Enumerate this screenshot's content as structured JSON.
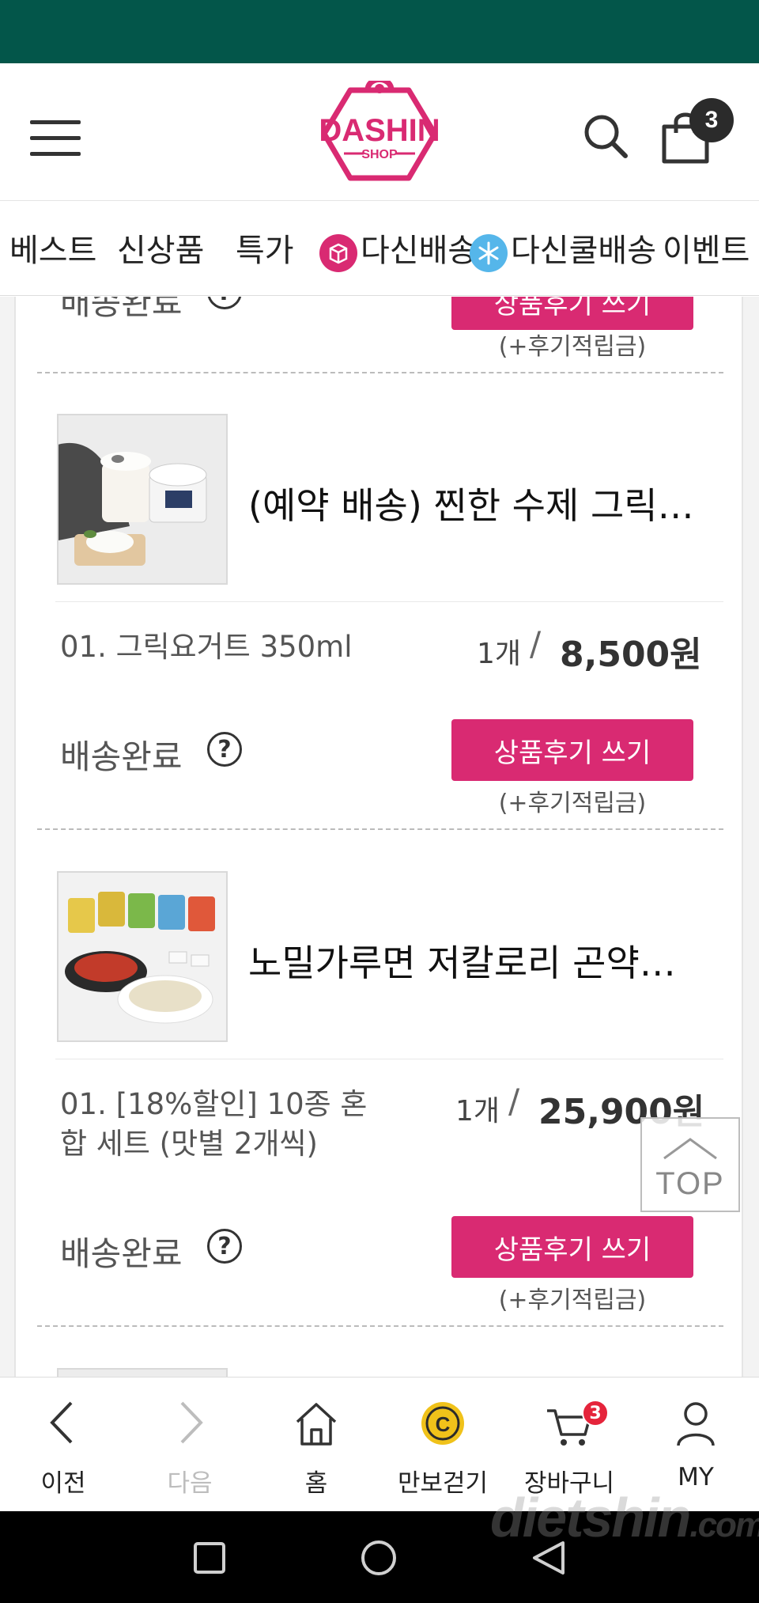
{
  "header": {
    "logo_text": "DASHIN",
    "logo_sub": "SHOP",
    "cart_count": "3"
  },
  "categories": {
    "best": "베스트",
    "new": "신상품",
    "sale": "특가",
    "dashin_delivery": "다신배송",
    "dashin_cool_delivery": "다신쿨배송",
    "event": "이벤트"
  },
  "orders": {
    "prev": {
      "status": "배송완료",
      "review_label": "상품후기 쓰기",
      "point_note": "(+후기적립금)"
    },
    "items": [
      {
        "title": "(예약 배송) 찐한 수제 그릭…",
        "option": "01. 그릭요거트 350ml",
        "qty": "1개",
        "slash": "/",
        "price": "8,500원",
        "status": "배송완료",
        "help": "?",
        "review_label": "상품후기 쓰기",
        "point_note": "(+후기적립금)"
      },
      {
        "title": "노밀가루면 저칼로리 곤약…",
        "option_line1": "01. [18%할인] 10종 혼",
        "option_line2": "합 세트 (맛별 2개씩)",
        "qty": "1개",
        "slash": "/",
        "price": "25,900원",
        "status": "배송완료",
        "help": "?",
        "review_label": "상품후기 쓰기",
        "point_note": "(+후기적립금)"
      }
    ]
  },
  "top_button": "TOP",
  "bottom_nav": {
    "prev": "이전",
    "next": "다음",
    "home": "홈",
    "pedometer": "만보걷기",
    "cart": "장바구니",
    "cart_count": "3",
    "my": "MY"
  },
  "watermark": {
    "main": "dietshin",
    "suffix": ".com"
  },
  "colors": {
    "status_bar": "#03564a",
    "accent": "#d92a72",
    "nav_disabled": "#bdbdbd"
  }
}
